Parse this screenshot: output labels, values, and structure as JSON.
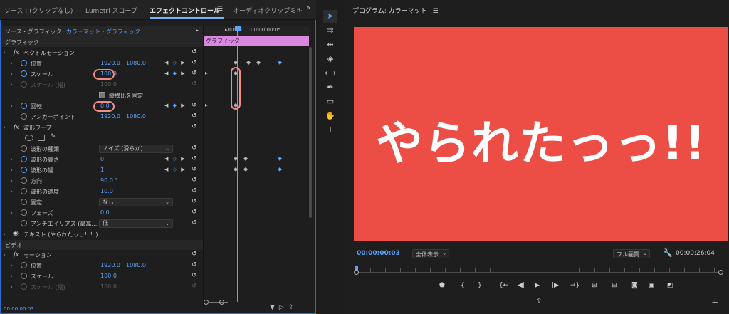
{
  "tabs": {
    "source": "ソース : (クリップなし)",
    "lumetri": "Lumetri スコープ",
    "effect": "エフェクトコントロール",
    "menu_icon": "☰",
    "audio": "オーディオクリップミキ",
    "more": "»"
  },
  "ec": {
    "source_label": "ソース・グラフィック",
    "clip_label": "カラーマット・グラフィック",
    "clip_arrow": "▸",
    "section_graphic": "グラフィック",
    "vector_motion": "ベクトルモーション",
    "position": "位置",
    "position_x": "1920.0",
    "position_y": "1080.0",
    "scale": "スケール",
    "scale_val": "100.0",
    "scale_w": "スケール (幅)",
    "scale_w_val": "100.0",
    "uniform_scale": "縦横比を固定",
    "rotation": "回転",
    "rotation_val": "0.0 °",
    "anchor": "アンカーポイント",
    "anchor_x": "1920.0",
    "anchor_y": "1080.0",
    "wave_warp": "波形ワープ",
    "wave_type": "波形の種類",
    "wave_type_val": "ノイズ (滑らか)",
    "wave_height": "波形の高さ",
    "wave_height_val": "0",
    "wave_width": "波形の幅",
    "wave_width_val": "1",
    "direction": "方向",
    "direction_val": "90.0 °",
    "wave_speed": "波形の速度",
    "wave_speed_val": "10.0",
    "pinning": "固定",
    "pinning_val": "なし",
    "phase": "フェーズ",
    "phase_val": "0.0",
    "antialias": "アンチエイリアス (最高…",
    "antialias_val": "低",
    "text_layer": "テキスト (やられたっっ！！)",
    "section_video": "ビデオ",
    "motion": "モーション",
    "v_position": "位置",
    "v_position_x": "1920.0",
    "v_position_y": "1080.0",
    "v_scale": "スケール",
    "v_scale_val": "100.0",
    "v_scale_w": "スケール (幅)",
    "v_scale_w_val": "100.0",
    "bottom_timecode": "00:00:00:03"
  },
  "mini_timeline": {
    "tc_start": "▸00:00",
    "tc_mid": "00:00:00:05",
    "clip_name": "グラフィック"
  },
  "program": {
    "title": "プログラム: カラーマット",
    "menu_icon": "☰",
    "caption": "やられたっっ!!",
    "timecode": "00:00:00:03",
    "fit": "全体表示",
    "quality": "フル画質",
    "duration": "00:00:26:04",
    "matte_color": "#ec4e45"
  }
}
